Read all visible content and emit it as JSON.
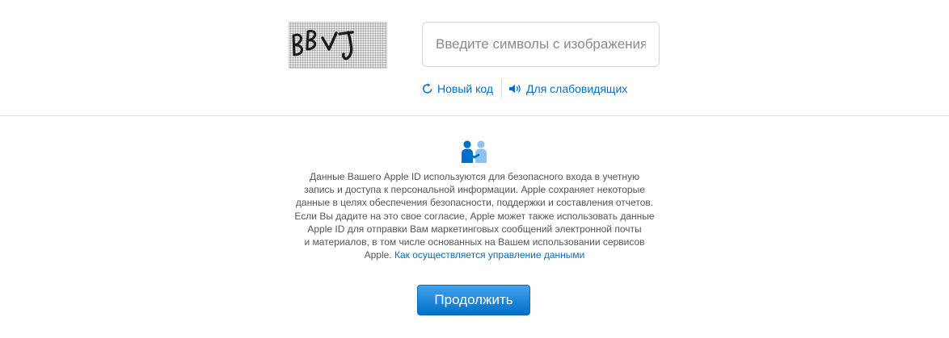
{
  "captcha": {
    "image_text": "BBVJ",
    "input_placeholder": "Введите символы с изображения",
    "input_value": "",
    "new_code_label": "Новый код",
    "new_code_icon": "refresh-icon",
    "audio_label": "Для слабовидящих",
    "audio_icon": "speaker-icon"
  },
  "privacy": {
    "icon": "handshake-people-icon",
    "lines": [
      "Данные Вашего Apple ID используются для безопасного входа в учетную",
      "запись и доступа к персональной информации. Apple сохраняет некоторые",
      "данные в целях обеспечения безопасности, поддержки и составления отчетов.",
      "Если Вы дадите на это свое согласие, Apple может также использовать данные",
      "Apple ID для отправки Вам маркетинговых сообщений электронной почты",
      "и материалов, в том числе основанных на Вашем использовании сервисов"
    ],
    "last_line_prefix": "Apple.",
    "link_label": "Как осуществляется управление данными"
  },
  "continue_button": {
    "label": "Продолжить"
  },
  "colors": {
    "link": "#0070c9",
    "button_top": "#42a1ec",
    "button_bottom": "#0070c9",
    "icon_dark": "#0070c9",
    "icon_light": "#8fc3ee"
  }
}
